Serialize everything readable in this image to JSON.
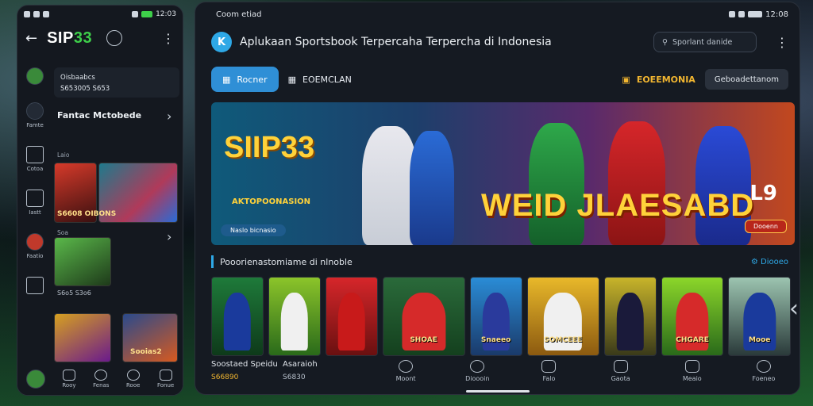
{
  "phone": {
    "status_time": "12:03",
    "brand_prefix": "SIP",
    "brand_suffix": "33",
    "profile_line1": "Oisbaabcs",
    "profile_line2": "S653005 S653",
    "section1_title": "Fantac Mctobede",
    "section1_sub": "Laio",
    "section2_sub": "Soa",
    "thumb1_label": "S6608 OIBONS",
    "thumb2_label": "S6o5 S3o6",
    "thumb3_label": "Sooias2",
    "nav_side": [
      {
        "label": "Famte"
      },
      {
        "label": "Cotoa"
      },
      {
        "label": "Iastt"
      },
      {
        "label": "Faatio"
      }
    ],
    "bottom_nav": [
      {
        "label": "Rooy"
      },
      {
        "label": "Fenas"
      },
      {
        "label": "Rooe"
      },
      {
        "label": "Fonue"
      }
    ]
  },
  "tablet": {
    "status_left": "Coom etiad",
    "status_time": "12:08",
    "title": "Aplukaan Sportsbook Terpercaha Terpercha di Indonesia",
    "search_placeholder": "Sporlant danide",
    "tabs": [
      {
        "label": "Rocner",
        "active": true
      },
      {
        "label": "EOEMCLAN",
        "active": false
      }
    ],
    "promo_label": "EOEEMONIA",
    "pill_label": "Geboadettanom",
    "banner": {
      "logo": "SIIP33",
      "subtitle": "AKTOPOONASION",
      "button": "Naslo bicnasio",
      "headline": "WEID JLAESABD",
      "corner": "L9",
      "corner_button": "Dooenn"
    },
    "section_title": "Pooorienastomiame di nlnoble",
    "see_all": "Diooeo",
    "cards": [
      {
        "label": ""
      },
      {
        "label": ""
      },
      {
        "label": ""
      },
      {
        "label": "SHOAE"
      },
      {
        "label": "Snaeeo"
      },
      {
        "label": "SOMCEEE"
      },
      {
        "label": ""
      },
      {
        "label": "CHGARE"
      },
      {
        "label": "Mooe"
      }
    ],
    "bottom_left": {
      "title": "Soostaed Speidu",
      "odds": "S66890"
    },
    "bottom_mid": {
      "title": "Asaraioh",
      "odds": "S6830"
    },
    "bottom_nav": [
      {
        "label": "Moont"
      },
      {
        "label": "Dioooin"
      },
      {
        "label": "Falo"
      },
      {
        "label": "Gaota"
      },
      {
        "label": "Meaio"
      },
      {
        "label": "Foeneo"
      }
    ]
  },
  "colors": {
    "accent_blue": "#2f8fd6",
    "gold": "#f2b630",
    "brand_green": "#3ecf4a",
    "panel": "#151a22"
  }
}
